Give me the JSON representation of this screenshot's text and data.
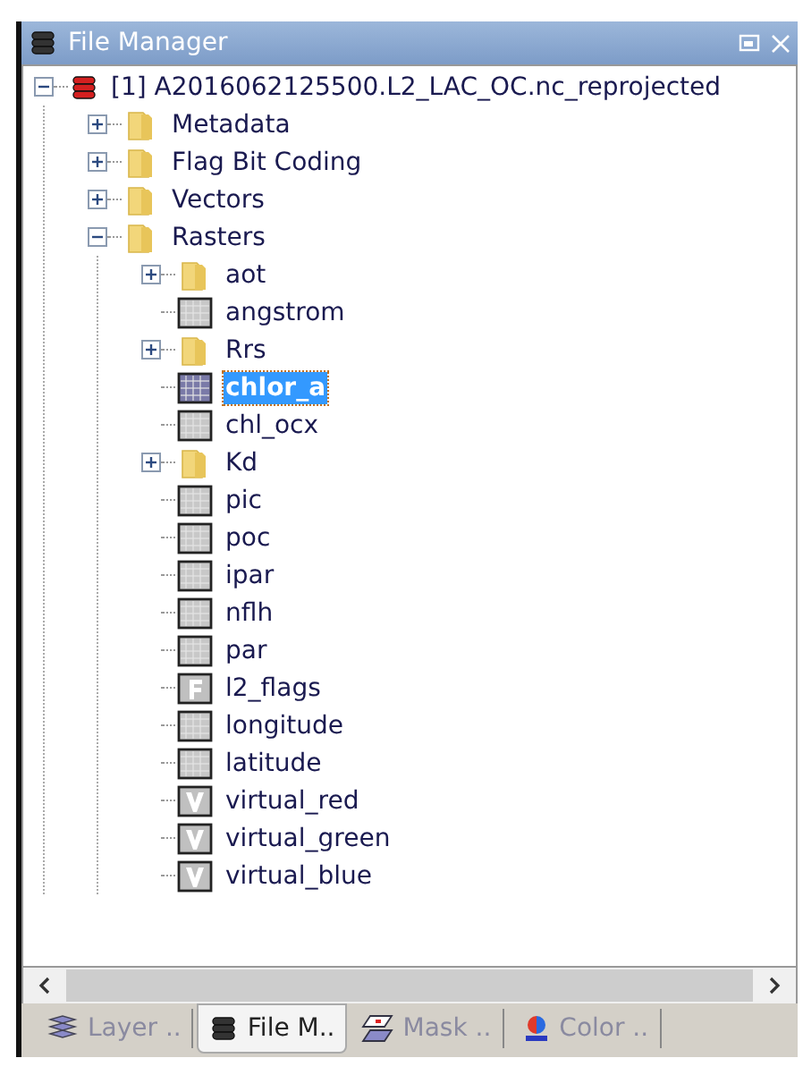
{
  "window": {
    "title": "File Manager"
  },
  "tree": [
    {
      "label": "[1] A2016062125500.L2_LAC_OC.nc_reprojected",
      "kind": "product",
      "expanded": true,
      "selected": false,
      "children": [
        {
          "label": "Metadata",
          "kind": "folder",
          "expanded": false,
          "selected": false
        },
        {
          "label": "Flag Bit Coding",
          "kind": "folder",
          "expanded": false,
          "selected": false
        },
        {
          "label": "Vectors",
          "kind": "folder",
          "expanded": false,
          "selected": false
        },
        {
          "label": "Rasters",
          "kind": "folder",
          "expanded": true,
          "selected": false,
          "children": [
            {
              "label": "aot",
              "kind": "folder",
              "expanded": false,
              "selected": false
            },
            {
              "label": "angstrom",
              "kind": "band",
              "selected": false
            },
            {
              "label": "Rrs",
              "kind": "folder",
              "expanded": false,
              "selected": false
            },
            {
              "label": "chlor_a",
              "kind": "band",
              "selected": true
            },
            {
              "label": "chl_ocx",
              "kind": "band",
              "selected": false
            },
            {
              "label": "Kd",
              "kind": "folder",
              "expanded": false,
              "selected": false
            },
            {
              "label": "pic",
              "kind": "band",
              "selected": false
            },
            {
              "label": "poc",
              "kind": "band",
              "selected": false
            },
            {
              "label": "ipar",
              "kind": "band",
              "selected": false
            },
            {
              "label": "nflh",
              "kind": "band",
              "selected": false
            },
            {
              "label": "par",
              "kind": "band",
              "selected": false
            },
            {
              "label": "l2_flags",
              "kind": "flag",
              "selected": false
            },
            {
              "label": "longitude",
              "kind": "band",
              "selected": false
            },
            {
              "label": "latitude",
              "kind": "band",
              "selected": false
            },
            {
              "label": "virtual_red",
              "kind": "virtual",
              "selected": false
            },
            {
              "label": "virtual_green",
              "kind": "virtual",
              "selected": false
            },
            {
              "label": "virtual_blue",
              "kind": "virtual",
              "selected": false
            }
          ]
        }
      ]
    }
  ],
  "tabs": [
    {
      "label": "Layer ..",
      "kind": "layers",
      "selected": false
    },
    {
      "label": "File M..",
      "kind": "files",
      "selected": true
    },
    {
      "label": "Mask ..",
      "kind": "mask",
      "selected": false
    },
    {
      "label": "Color ..",
      "kind": "color",
      "selected": false
    }
  ]
}
